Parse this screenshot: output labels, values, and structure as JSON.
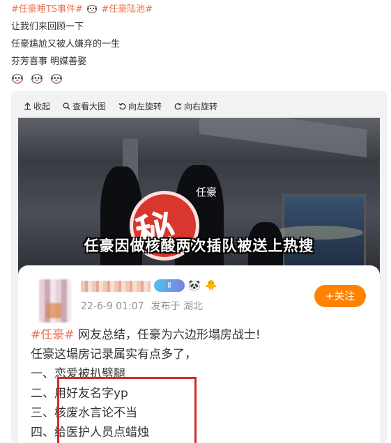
{
  "post": {
    "tag1": "#任豪睡TS事件#",
    "tag2": "#任豪陆池#",
    "line1": "让我们来回顾一下",
    "line2": "任豪尴尬又被人嫌弃的一生",
    "line3": "芬芳喜事 明媒善娶"
  },
  "toolbar": {
    "collapse": "收起",
    "view_large": "查看大图",
    "rotate_left": "向左旋转",
    "rotate_right": "向右旋转"
  },
  "image": {
    "name_caption": "任豪",
    "stamp_char": "秘",
    "headline": "任豪因做核酸两次插队被送上热搜",
    "card": {
      "level": "Ⅱ",
      "date": "22-6-9 01:07",
      "published_from": "发布于 湖北",
      "follow_label": "+关注",
      "tag": "#任豪#",
      "text1": "网友总结，任豪为六边形塌房战士!",
      "text2": "任豪这塌房记录属实有点多了，",
      "item1": "一、恋爱被扒劈腿",
      "item2": "二、用好友名字yp",
      "item3": "三、核废水言论不当",
      "item4": "四、给医护人员点蜡烛"
    }
  },
  "colors": {
    "tag": "#eb7350",
    "follow": "#ff8200",
    "highlight_box": "#d12b2b",
    "toolbar_bg": "#f2f2f5"
  },
  "icons": [
    "up-arrow-icon",
    "search-icon",
    "rotate-left-icon",
    "rotate-right-icon",
    "dog-emoji-icon"
  ]
}
